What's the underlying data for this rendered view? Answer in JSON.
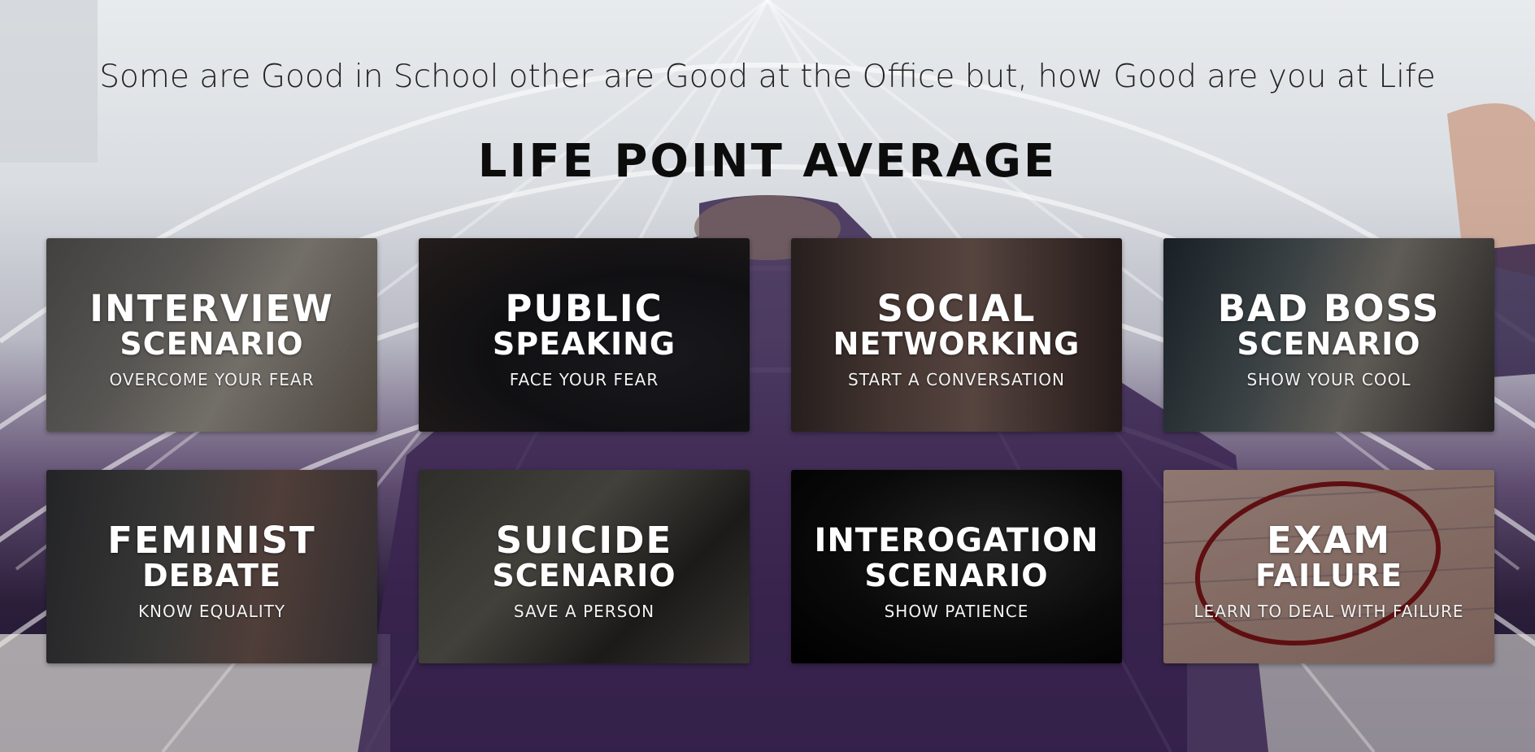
{
  "header": {
    "tagline": "Some are Good in School other are Good at the Office but, how Good are you at Life",
    "title": "LIFE POINT AVERAGE"
  },
  "cards": [
    {
      "line1": "INTERVIEW",
      "line2": "SCENARIO",
      "subtitle": "OVERCOME YOUR FEAR"
    },
    {
      "line1": "PUBLIC",
      "line2": "SPEAKING",
      "subtitle": "FACE YOUR FEAR"
    },
    {
      "line1": "SOCIAL",
      "line2": "NETWORKING",
      "subtitle": "START A CONVERSATION"
    },
    {
      "line1": "BAD BOSS",
      "line2": "SCENARIO",
      "subtitle": "SHOW YOUR COOL"
    },
    {
      "line1": "FEMINIST",
      "line2": "DEBATE",
      "subtitle": "KNOW EQUALITY"
    },
    {
      "line1": "SUICIDE",
      "line2": "SCENARIO",
      "subtitle": "SAVE A PERSON"
    },
    {
      "line1": "INTEROGATION",
      "line2": "SCENARIO",
      "subtitle": "SHOW PATIENCE"
    },
    {
      "line1": "EXAM",
      "line2": "FAILURE",
      "subtitle": "LEARN TO DEAL WITH FAILURE"
    }
  ]
}
